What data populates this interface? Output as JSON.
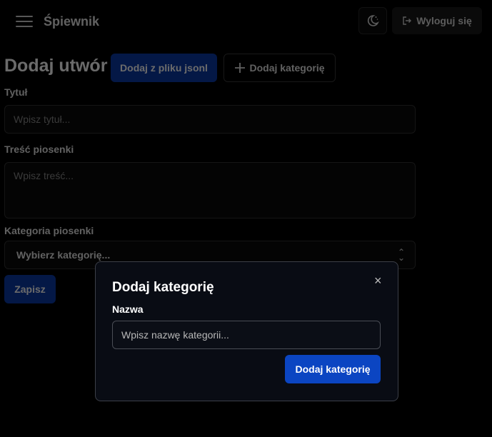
{
  "app": {
    "title": "Śpiewnik",
    "logout_label": "Wyloguj się"
  },
  "page": {
    "title": "Dodaj utwór",
    "json_button": "Dodaj z pliku jsonl",
    "add_category_button": "Dodaj kategorię",
    "title_label": "Tytuł",
    "title_placeholder": "Wpisz tytuł...",
    "content_label": "Treść piosenki",
    "content_placeholder": "Wpisz treść...",
    "category_label": "Kategoria piosenki",
    "category_selected": "Wybierz kategorię...",
    "save_button": "Zapisz"
  },
  "modal": {
    "title": "Dodaj kategorię",
    "name_label": "Nazwa",
    "name_placeholder": "Wpisz nazwę kategorii...",
    "submit_button": "Dodaj kategorię",
    "close_symbol": "×"
  },
  "colors": {
    "primary": "#0b45c2",
    "background": "#000000",
    "modal_bg": "#090c14"
  },
  "icons": [
    "hamburger-menu-icon",
    "theme-toggle-icon",
    "logout-icon",
    "plus-icon",
    "chevron-updown-icon",
    "close-icon"
  ]
}
